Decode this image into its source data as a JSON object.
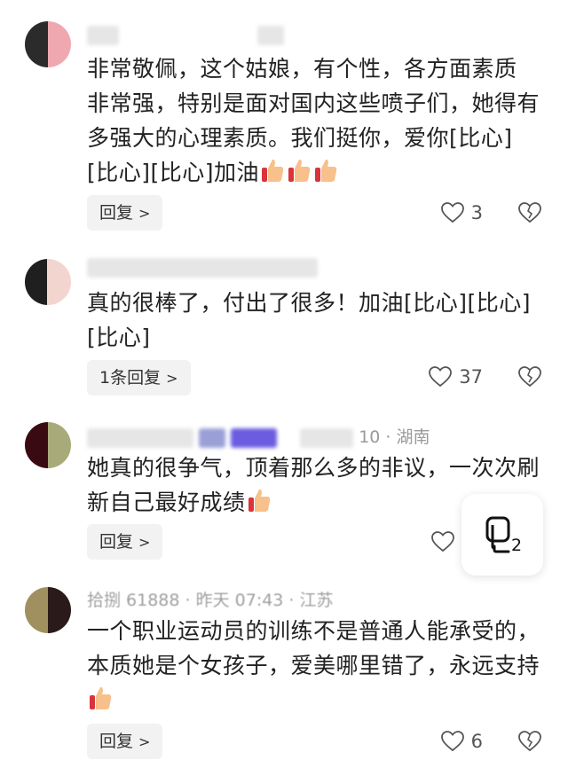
{
  "comments": [
    {
      "meta": "",
      "text": "非常敬佩，这个姑娘，有个性，各方面素质非常强，特别是面对国内这些喷子们，她得有多强大的心理素质。我们挺你，爱你[比心][比心][比心]加油",
      "reply_label": "回复",
      "likes": "3"
    },
    {
      "meta": "",
      "text": "真的很棒了，付出了很多！加油[比心][比心][比心]",
      "reply_label": "1条回复",
      "likes": "37"
    },
    {
      "meta": "10 · 湖南",
      "text": "她真的很争气，顶着那么多的非议，一次次刷新自己最好成绩",
      "reply_label": "回复",
      "likes": ""
    },
    {
      "meta": "拾捌 61888 · 昨天 07:43 · 江苏",
      "text": "一个职业运动员的训练不是普通人能承受的，本质她是个女孩子，爱美哪里错了，永远支持",
      "reply_label": "回复",
      "likes": "6"
    }
  ],
  "float_button": {
    "count": "2",
    "icon": "copy-icon"
  },
  "colors": {
    "reply_bg": "#f2f2f2",
    "meta": "#9a9a9a",
    "thumb": "#f5a623"
  }
}
